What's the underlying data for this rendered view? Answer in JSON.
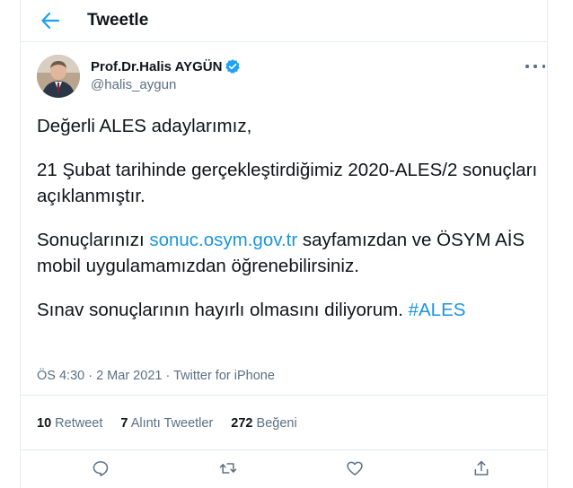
{
  "header": {
    "title": "Tweetle"
  },
  "author": {
    "name": "Prof.Dr.Halis AYGÜN",
    "handle": "@halis_aygun"
  },
  "tweet": {
    "p1": "Değerli ALES adaylarımız,",
    "p2": "21 Şubat tarihinde gerçekleştirdiğimiz 2020-ALES/2 sonuçları açıklanmıştır.",
    "p3_before": "Sonuçlarınızı ",
    "p3_link": "sonuc.osym.gov.tr",
    "p3_after": " sayfamızdan ve ÖSYM AİS mobil uygulamamızdan öğrenebilirsiniz.",
    "p4_before": "Sınav sonuçlarının hayırlı olmasını diliyorum. ",
    "p4_hashtag": "#ALES"
  },
  "meta": {
    "time": "ÖS 4:30",
    "separator": " · ",
    "date": "2 Mar 2021",
    "source": "Twitter for iPhone"
  },
  "stats": {
    "retweets": {
      "count": "10",
      "label": "Retweet"
    },
    "quotes": {
      "count": "7",
      "label": "Alıntı Tweetler"
    },
    "likes": {
      "count": "272",
      "label": "Beğeni"
    }
  },
  "icons": {
    "back": "arrow-left-icon",
    "verified": "verified-badge-icon",
    "more": "more-horizontal-icon",
    "reply": "reply-icon",
    "retweet": "retweet-icon",
    "like": "heart-icon",
    "share": "share-icon"
  },
  "colors": {
    "accent": "#1da1f2",
    "link": "#1b95e0",
    "secondary_text": "#5b7083",
    "divider": "#e6ecf0"
  }
}
